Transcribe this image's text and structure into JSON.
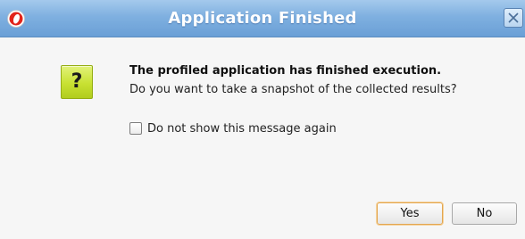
{
  "window": {
    "title": "Application Finished"
  },
  "message": {
    "title": "The profiled application has finished execution.",
    "body": "Do you want to take a snapshot of the collected results?"
  },
  "checkbox": {
    "label": "Do not show this message again",
    "checked": false
  },
  "buttons": {
    "yes": "Yes",
    "no": "No"
  },
  "icons": {
    "app": "app-logo-icon",
    "message": "question-icon",
    "close": "close-icon"
  },
  "colors": {
    "title_bar": "#7fb0e0",
    "question_icon": "#c8e132",
    "default_button_focus": "#e3a650"
  }
}
